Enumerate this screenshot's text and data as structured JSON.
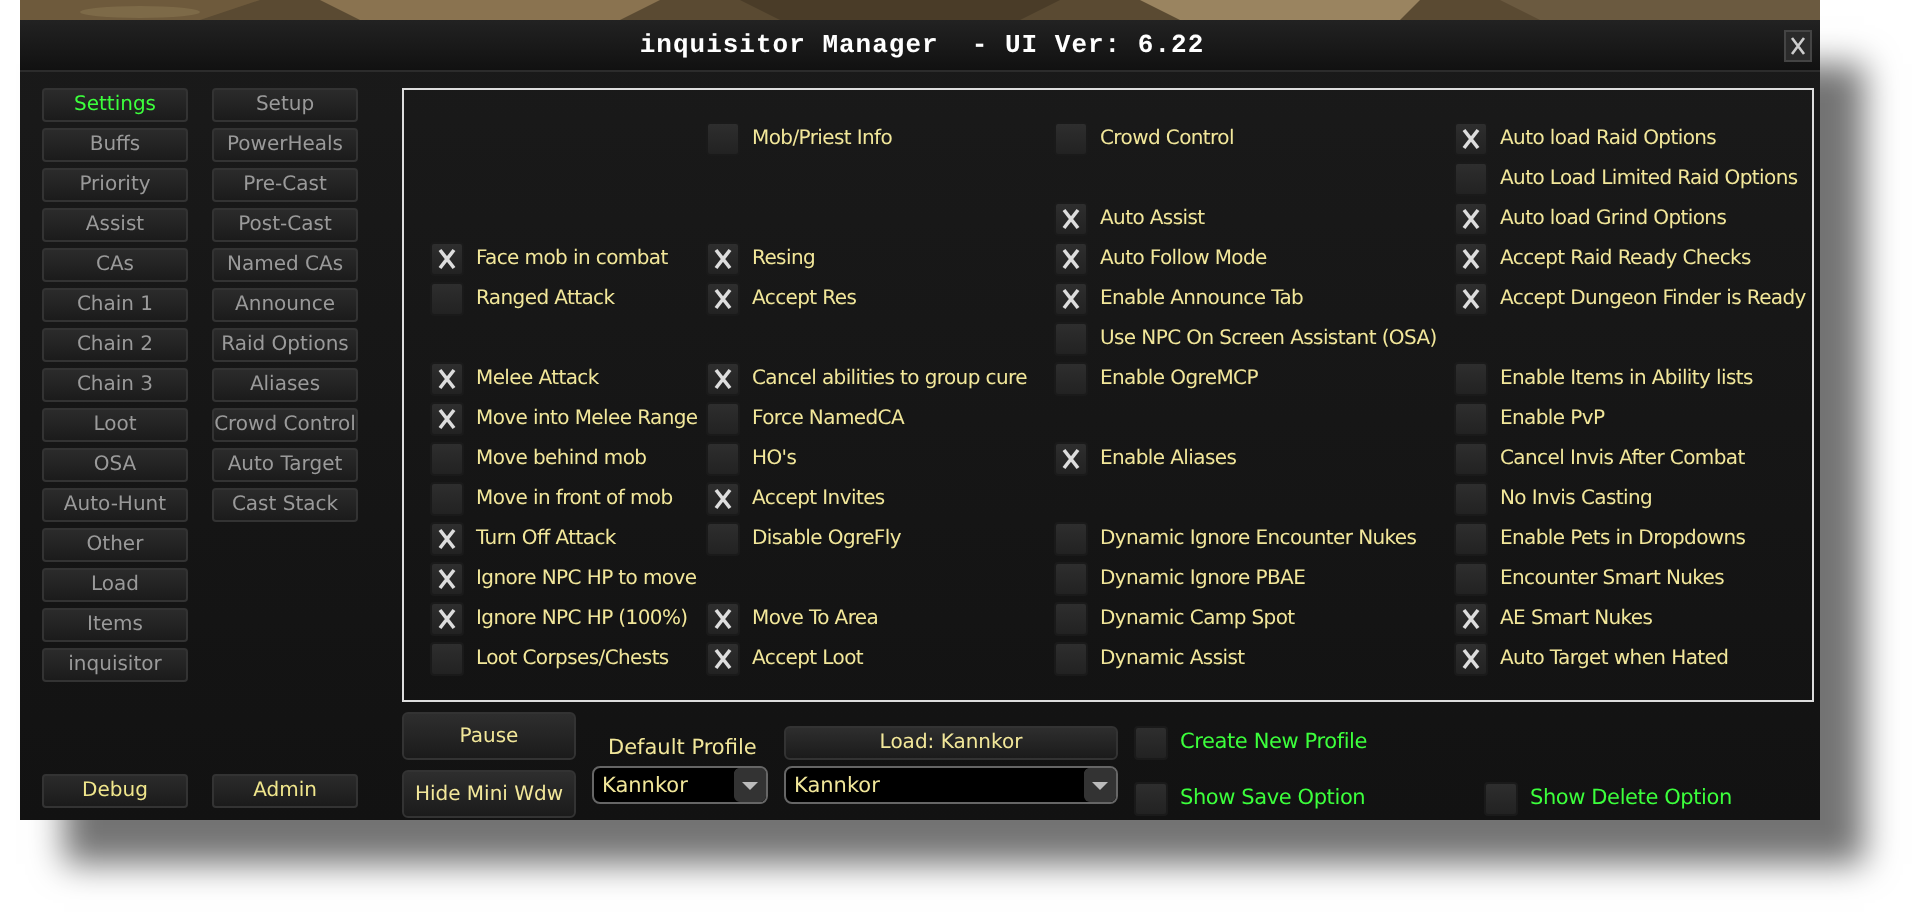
{
  "window": {
    "title": "inquisitor Manager  - UI Ver: 6.22"
  },
  "nav_left": [
    {
      "label": "Settings",
      "selected": true
    },
    {
      "label": "Buffs",
      "selected": false
    },
    {
      "label": "Priority",
      "selected": false
    },
    {
      "label": "Assist",
      "selected": false
    },
    {
      "label": "CAs",
      "selected": false
    },
    {
      "label": "Chain 1",
      "selected": false
    },
    {
      "label": "Chain 2",
      "selected": false
    },
    {
      "label": "Chain 3",
      "selected": false
    },
    {
      "label": "Loot",
      "selected": false
    },
    {
      "label": "OSA",
      "selected": false
    },
    {
      "label": "Auto-Hunt",
      "selected": false
    },
    {
      "label": "Other",
      "selected": false
    },
    {
      "label": "Load",
      "selected": false
    },
    {
      "label": "Items",
      "selected": false
    },
    {
      "label": "inquisitor",
      "selected": false
    }
  ],
  "nav_right": [
    {
      "label": "Setup",
      "selected": false
    },
    {
      "label": "PowerHeals",
      "selected": false
    },
    {
      "label": "Pre-Cast",
      "selected": false
    },
    {
      "label": "Post-Cast",
      "selected": false
    },
    {
      "label": "Named CAs",
      "selected": false
    },
    {
      "label": "Announce",
      "selected": false
    },
    {
      "label": "Raid Options",
      "selected": false
    },
    {
      "label": "Aliases",
      "selected": false
    },
    {
      "label": "Crowd Control",
      "selected": false
    },
    {
      "label": "Auto Target",
      "selected": false
    },
    {
      "label": "Cast Stack",
      "selected": false
    }
  ],
  "nav_footer": [
    "Debug",
    "Admin"
  ],
  "option_columns": [
    [
      {
        "kind": "blank"
      },
      {
        "kind": "blank"
      },
      {
        "kind": "blank"
      },
      {
        "kind": "checkbox",
        "label": "Face mob in combat",
        "checked": true
      },
      {
        "kind": "checkbox",
        "label": "Ranged Attack",
        "checked": false
      },
      {
        "kind": "blank"
      },
      {
        "kind": "checkbox",
        "label": "Melee Attack",
        "checked": true
      },
      {
        "kind": "checkbox",
        "label": "Move into Melee Range",
        "checked": true
      },
      {
        "kind": "checkbox",
        "label": "Move behind mob",
        "checked": false
      },
      {
        "kind": "checkbox",
        "label": "Move in front of mob",
        "checked": false
      },
      {
        "kind": "checkbox",
        "label": "Turn Off Attack",
        "checked": true
      },
      {
        "kind": "checkbox",
        "label": "Ignore NPC HP to move",
        "checked": true
      },
      {
        "kind": "checkbox",
        "label": "Ignore NPC HP (100%)",
        "checked": true
      },
      {
        "kind": "checkbox",
        "label": "Loot Corpses/Chests",
        "checked": false
      }
    ],
    [
      {
        "kind": "checkbox",
        "label": "Mob/Priest Info",
        "checked": false
      },
      {
        "kind": "blank"
      },
      {
        "kind": "blank"
      },
      {
        "kind": "checkbox",
        "label": "Resing",
        "checked": true
      },
      {
        "kind": "checkbox",
        "label": "Accept Res",
        "checked": true
      },
      {
        "kind": "blank"
      },
      {
        "kind": "checkbox",
        "label": "Cancel abilities to group cure",
        "checked": true
      },
      {
        "kind": "checkbox",
        "label": "Force NamedCA",
        "checked": false
      },
      {
        "kind": "checkbox",
        "label": "HO's",
        "checked": false
      },
      {
        "kind": "checkbox",
        "label": "Accept Invites",
        "checked": true
      },
      {
        "kind": "checkbox",
        "label": "Disable OgreFly",
        "checked": false
      },
      {
        "kind": "blank"
      },
      {
        "kind": "checkbox",
        "label": "Move To Area",
        "checked": true
      },
      {
        "kind": "checkbox",
        "label": "Accept Loot",
        "checked": true
      }
    ],
    [
      {
        "kind": "checkbox",
        "label": "Crowd Control",
        "checked": false
      },
      {
        "kind": "blank"
      },
      {
        "kind": "checkbox",
        "label": "Auto Assist",
        "checked": true
      },
      {
        "kind": "checkbox",
        "label": "Auto Follow Mode",
        "checked": true
      },
      {
        "kind": "checkbox",
        "label": "Enable Announce Tab",
        "checked": true
      },
      {
        "kind": "checkbox",
        "label": "Use NPC On Screen Assistant (OSA)",
        "checked": false
      },
      {
        "kind": "checkbox",
        "label": "Enable OgreMCP",
        "checked": false
      },
      {
        "kind": "blank"
      },
      {
        "kind": "checkbox",
        "label": "Enable Aliases",
        "checked": true
      },
      {
        "kind": "blank"
      },
      {
        "kind": "checkbox",
        "label": "Dynamic Ignore Encounter Nukes",
        "checked": false
      },
      {
        "kind": "checkbox",
        "label": "Dynamic Ignore PBAE",
        "checked": false
      },
      {
        "kind": "checkbox",
        "label": "Dynamic Camp Spot",
        "checked": false
      },
      {
        "kind": "checkbox",
        "label": "Dynamic Assist",
        "checked": false
      }
    ],
    [
      {
        "kind": "checkbox",
        "label": "Auto load Raid Options",
        "checked": true
      },
      {
        "kind": "checkbox",
        "label": "Auto Load Limited Raid Options",
        "checked": false
      },
      {
        "kind": "checkbox",
        "label": "Auto load Grind Options",
        "checked": true
      },
      {
        "kind": "checkbox",
        "label": "Accept Raid Ready Checks",
        "checked": true
      },
      {
        "kind": "checkbox",
        "label": "Accept Dungeon Finder is Ready",
        "checked": true
      },
      {
        "kind": "blank"
      },
      {
        "kind": "checkbox",
        "label": "Enable Items in Ability lists",
        "checked": false
      },
      {
        "kind": "checkbox",
        "label": "Enable PvP",
        "checked": false
      },
      {
        "kind": "checkbox",
        "label": "Cancel Invis After Combat",
        "checked": false
      },
      {
        "kind": "checkbox",
        "label": "No Invis Casting",
        "checked": false
      },
      {
        "kind": "checkbox",
        "label": "Enable Pets in Dropdowns",
        "checked": false
      },
      {
        "kind": "checkbox",
        "label": "Encounter Smart Nukes",
        "checked": false
      },
      {
        "kind": "checkbox",
        "label": "AE Smart Nukes",
        "checked": true
      },
      {
        "kind": "checkbox",
        "label": "Auto Target when Hated",
        "checked": true
      }
    ]
  ],
  "controls": {
    "pause": "Pause",
    "hide_mini": "Hide Mini Wdw",
    "profile_label": "Default Profile",
    "profile_dropdown": "Kannkor",
    "load_button": "Load: Kannkor",
    "load_dropdown": "Kannkor",
    "create_new_profile": {
      "label": "Create New Profile",
      "checked": false
    },
    "show_save_option": {
      "label": "Show Save Option",
      "checked": false
    },
    "show_delete_option": {
      "label": "Show Delete Option",
      "checked": false
    }
  }
}
